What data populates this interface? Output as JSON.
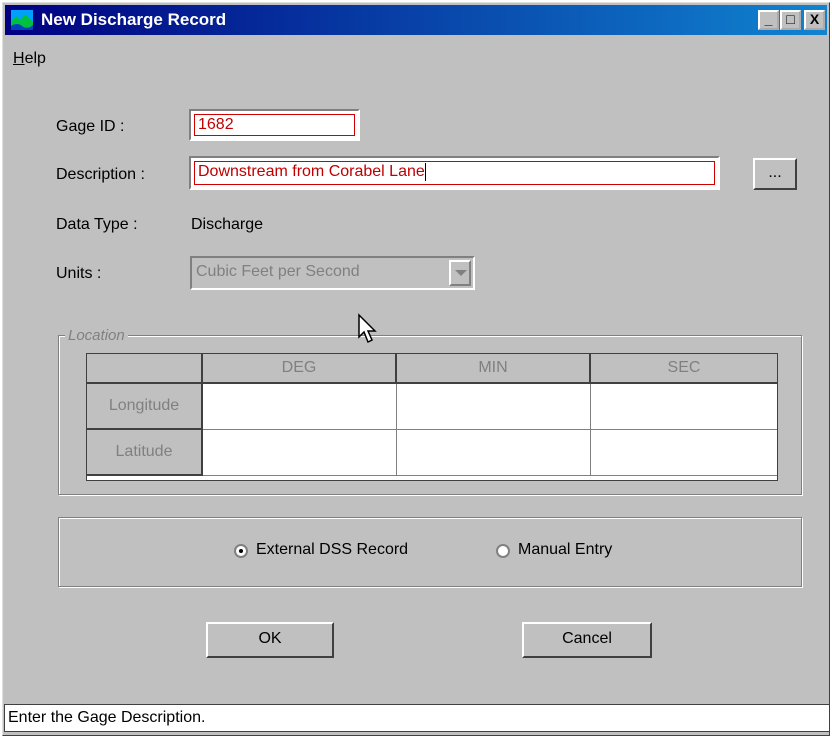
{
  "window": {
    "title": "New Discharge Record",
    "minimize_glyph": "_",
    "maximize_glyph": "□",
    "close_glyph": "X"
  },
  "menu": {
    "help_first": "H",
    "help_rest": "elp"
  },
  "form": {
    "gage_id_label": "Gage ID :",
    "gage_id_value": "1682",
    "description_label": "Description :",
    "description_value": "Downstream from Corabel Lane",
    "browse_label": "...",
    "data_type_label": "Data Type :",
    "data_type_value": "Discharge",
    "units_label": "Units :",
    "units_value": "Cubic Feet per Second"
  },
  "location": {
    "legend": "Location",
    "columns": [
      "DEG",
      "MIN",
      "SEC"
    ],
    "rows": [
      "Longitude",
      "Latitude"
    ]
  },
  "source": {
    "options": [
      "External DSS Record",
      "Manual Entry"
    ],
    "selected": "External DSS Record"
  },
  "buttons": {
    "ok": "OK",
    "cancel": "Cancel"
  },
  "status": {
    "text": "Enter the Gage Description."
  },
  "colors": {
    "title_start": "#000080",
    "title_end": "#1084d0",
    "input_text": "#c00000"
  }
}
